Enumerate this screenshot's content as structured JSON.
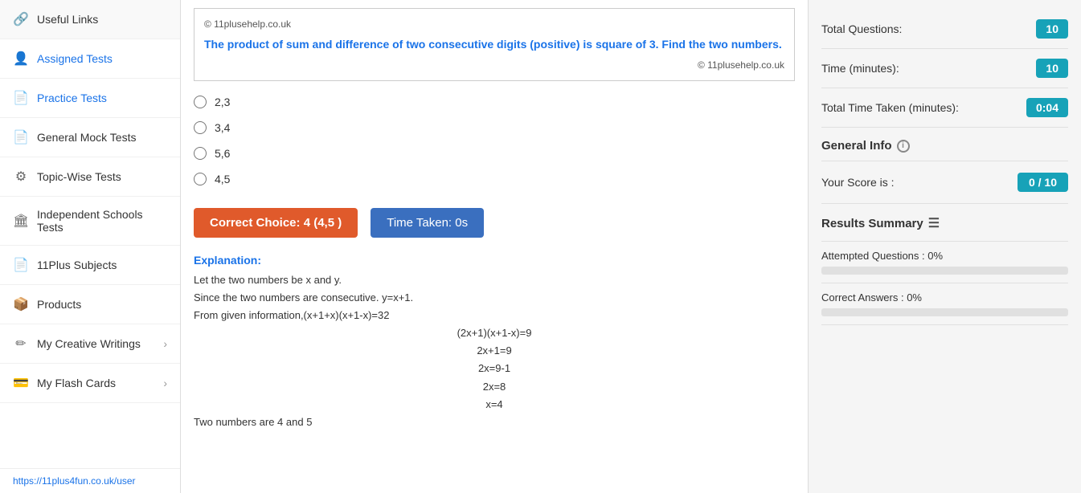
{
  "sidebar": {
    "items": [
      {
        "id": "useful-links",
        "label": "Useful Links",
        "icon": "🔗",
        "active": false,
        "hasArrow": false
      },
      {
        "id": "assigned-tests",
        "label": "Assigned Tests",
        "icon": "👤",
        "active": true,
        "hasArrow": false
      },
      {
        "id": "practice-tests",
        "label": "Practice Tests",
        "icon": "📄",
        "active": true,
        "hasArrow": false
      },
      {
        "id": "general-mock-tests",
        "label": "General Mock Tests",
        "icon": "📄",
        "active": false,
        "hasArrow": false
      },
      {
        "id": "topic-wise-tests",
        "label": "Topic-Wise Tests",
        "icon": "⚙",
        "active": false,
        "hasArrow": false
      },
      {
        "id": "independent-schools-tests",
        "label": "Independent Schools Tests",
        "icon": "🏛",
        "active": false,
        "hasArrow": false
      },
      {
        "id": "11plus-subjects",
        "label": "11Plus Subjects",
        "icon": "📄",
        "active": false,
        "hasArrow": false
      },
      {
        "id": "products",
        "label": "Products",
        "icon": "📦",
        "active": false,
        "hasArrow": false
      },
      {
        "id": "my-creative-writings",
        "label": "My Creative Writings",
        "icon": "✏",
        "active": false,
        "hasArrow": true
      },
      {
        "id": "my-flash-cards",
        "label": "My Flash Cards",
        "icon": "💳",
        "active": false,
        "hasArrow": true
      }
    ],
    "bottom_link": "https://11plus4fun.co.uk/user"
  },
  "question": {
    "copyright": "© 11plusehelp.co.uk",
    "text": "The product of sum and difference of two consecutive digits (positive) is square of 3. Find the two numbers.",
    "footer_copyright": "© 11plusehelp.co.uk",
    "options": [
      {
        "id": "opt1",
        "value": "2,3"
      },
      {
        "id": "opt2",
        "value": "3,4"
      },
      {
        "id": "opt3",
        "value": "5,6"
      },
      {
        "id": "opt4",
        "value": "4,5"
      }
    ],
    "correct_choice_label": "Correct Choice: 4 (4,5 )",
    "time_taken_label": "Time Taken: 0s"
  },
  "explanation": {
    "title": "Explanation:",
    "lines": [
      "Let the two numbers be x and y.",
      "Since the two numbers are consecutive. y=x+1.",
      "From given information,(x+1+x)(x+1-x)=32",
      "(2x+1)(x+1-x)=9",
      "2x+1=9",
      "2x=9-1",
      "2x=8",
      "x=4",
      "Two numbers are 4 and 5"
    ]
  },
  "right_panel": {
    "total_questions_label": "Total Questions:",
    "total_questions_value": "10",
    "time_minutes_label": "Time (minutes):",
    "time_minutes_value": "10",
    "total_time_taken_label": "Total Time Taken (minutes):",
    "total_time_taken_value": "0:04",
    "general_info_label": "General Info",
    "your_score_label": "Your Score is :",
    "your_score_value": "0 / 10",
    "results_summary_label": "Results Summary",
    "attempted_questions_label": "Attempted Questions : 0%",
    "attempted_questions_pct": 0,
    "correct_answers_label": "Correct Answers : 0%",
    "correct_answers_pct": 0
  }
}
